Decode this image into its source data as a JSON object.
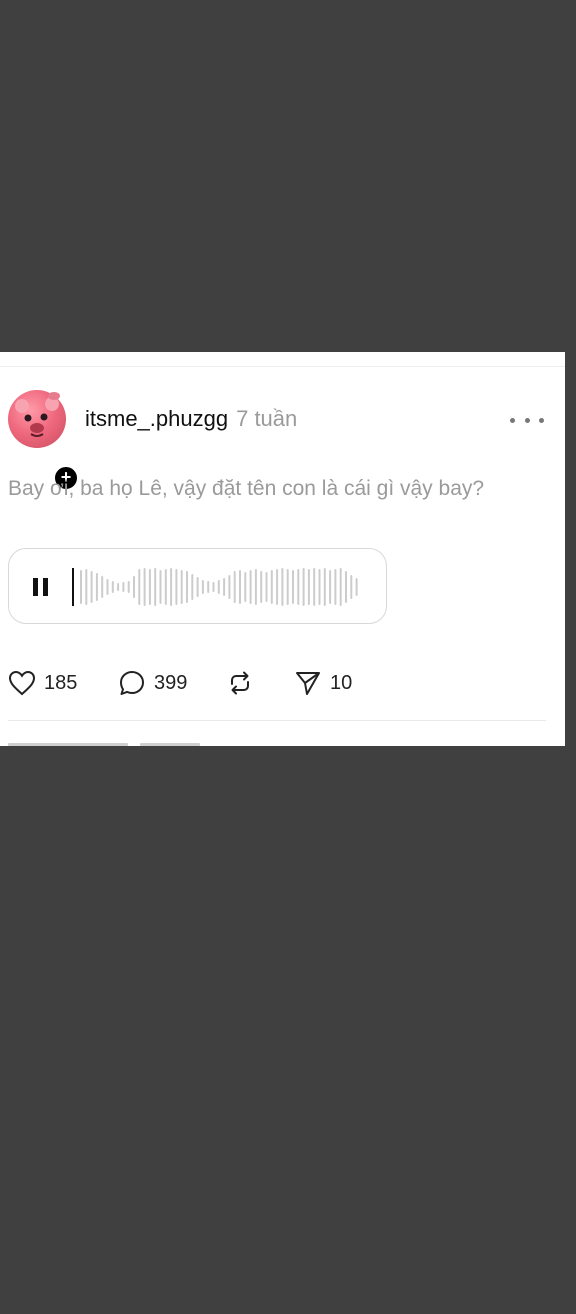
{
  "post": {
    "username": "itsme_.phuzgg",
    "time": "7 tuần",
    "text": "Bay ơi, ba họ Lê, vậy đặt tên con là cái gì vậy bay?",
    "audio": {
      "state": "playing",
      "progress": 0.0
    }
  },
  "actions": {
    "likes": "185",
    "comments": "399",
    "shares": "10"
  },
  "icons": [
    "heart-icon",
    "comment-icon",
    "repost-icon",
    "send-icon",
    "more-icon",
    "pause-icon",
    "plus-icon"
  ],
  "colors": {
    "background": "#404040",
    "card": "#ffffff",
    "muted_text": "#9a9a9a",
    "waveform": "#cccccc"
  }
}
